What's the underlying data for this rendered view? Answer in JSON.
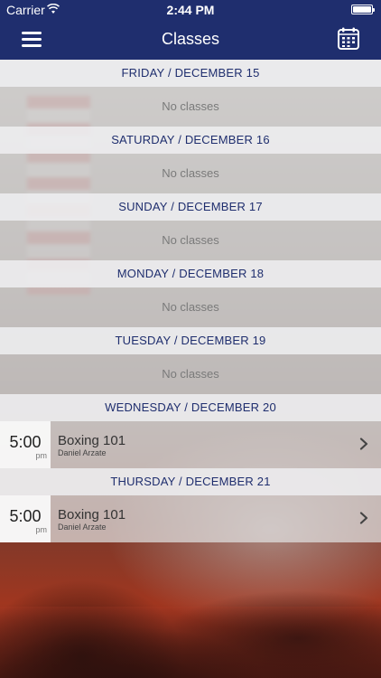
{
  "status_bar": {
    "carrier": "Carrier",
    "time": "2:44 PM"
  },
  "nav": {
    "title": "Classes",
    "menu_icon": "hamburger-menu-icon",
    "calendar_icon": "calendar-icon"
  },
  "colors": {
    "nav_bg": "#1f2e6e",
    "header_text": "#1f2e6e"
  },
  "days": [
    {
      "header": "FRIDAY / DECEMBER 15",
      "empty": "No classes"
    },
    {
      "header": "SATURDAY / DECEMBER 16",
      "empty": "No classes"
    },
    {
      "header": "SUNDAY / DECEMBER 17",
      "empty": "No classes"
    },
    {
      "header": "MONDAY / DECEMBER 18",
      "empty": "No classes"
    },
    {
      "header": "TUESDAY / DECEMBER 19",
      "empty": "No classes"
    },
    {
      "header": "WEDNESDAY / DECEMBER 20",
      "class": {
        "time": "5:00",
        "ampm": "pm",
        "name": "Boxing 101",
        "instructor": "Daniel Arzate"
      }
    },
    {
      "header": "THURSDAY / DECEMBER 21",
      "class": {
        "time": "5:00",
        "ampm": "pm",
        "name": "Boxing 101",
        "instructor": "Daniel Arzate"
      }
    }
  ]
}
